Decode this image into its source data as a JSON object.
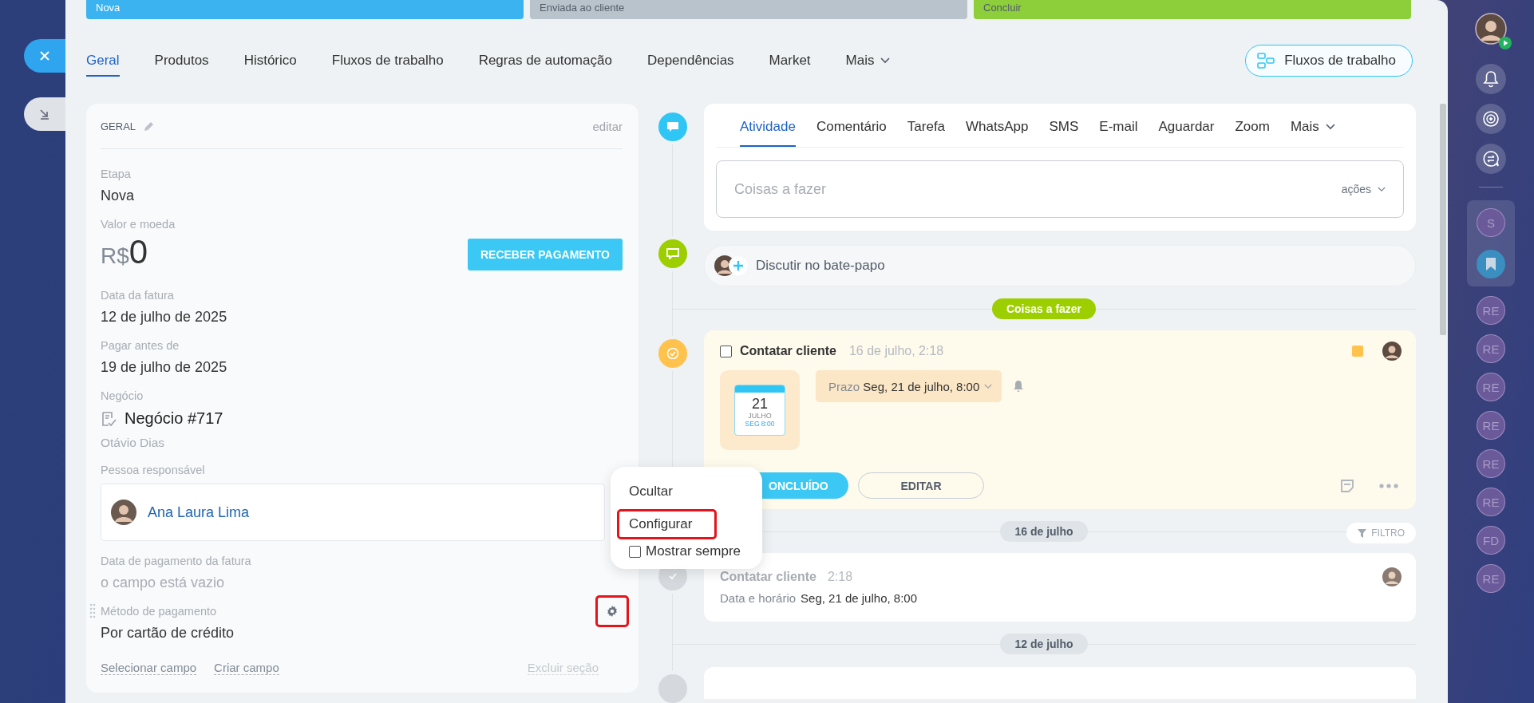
{
  "stages": [
    {
      "label": "Nova",
      "color": "#3bb3f0"
    },
    {
      "label": "Enviada ao cliente",
      "color": "#b9c3cc"
    },
    {
      "label": "Concluir",
      "color": "#8ccf3b"
    }
  ],
  "tabs": [
    {
      "label": "Geral",
      "selected": true
    },
    {
      "label": "Produtos",
      "selected": false
    },
    {
      "label": "Histórico",
      "selected": false
    },
    {
      "label": "Fluxos de trabalho",
      "selected": false
    },
    {
      "label": "Regras de automação",
      "selected": false
    },
    {
      "label": "Dependências",
      "selected": false
    },
    {
      "label": "Market",
      "selected": false
    },
    {
      "label": "Mais",
      "selected": false,
      "kind": "more"
    }
  ],
  "workflow_button": "Fluxos de trabalho",
  "section": {
    "title": "GERAL",
    "edit": "editar",
    "fields": [
      {
        "kind": "text",
        "label": "Etapa",
        "value": "Nova"
      },
      {
        "kind": "money",
        "label": "Valor e moeda",
        "currency": "R$",
        "amount": "0",
        "button": "RECEBER PAGAMENTO"
      },
      {
        "kind": "text",
        "label": "Data da fatura",
        "value": "12 de julho de 2025"
      },
      {
        "kind": "text",
        "label": "Pagar antes de",
        "value": "19 de julho de 2025"
      },
      {
        "kind": "deal",
        "label": "Negócio",
        "value": "Negócio #717",
        "sub": "Otávio Dias"
      },
      {
        "kind": "person",
        "label": "Pessoa responsável",
        "value": "Ana Laura Lima"
      },
      {
        "kind": "empty",
        "label": "Data de pagamento da fatura",
        "value": "o campo está vazio"
      },
      {
        "kind": "settings",
        "label": "Método de pagamento",
        "value": "Por cartão de crédito",
        "highlighted": true
      }
    ],
    "links": [
      "Selecionar campo",
      "Criar campo"
    ],
    "delete": "Excluir seção"
  },
  "context_menu": [
    {
      "kind": "action",
      "label": "Ocultar",
      "highlighted": false
    },
    {
      "kind": "action",
      "label": "Configurar",
      "highlighted": true
    },
    {
      "kind": "checkbox",
      "label": "Mostrar sempre",
      "checked": false
    }
  ],
  "activity_tabs": [
    {
      "label": "Atividade",
      "selected": true
    },
    {
      "label": "Comentário",
      "selected": false
    },
    {
      "label": "Tarefa",
      "selected": false
    },
    {
      "label": "WhatsApp",
      "selected": false
    },
    {
      "label": "SMS",
      "selected": false
    },
    {
      "label": "E-mail",
      "selected": false
    },
    {
      "label": "Aguardar",
      "selected": false
    },
    {
      "label": "Zoom",
      "selected": false
    },
    {
      "label": "Mais",
      "selected": false,
      "kind": "more"
    }
  ],
  "activity_input": {
    "placeholder": "Coisas a fazer",
    "actions": "ações"
  },
  "chat": "Discutir no bate-papo",
  "todo_pill": "Coisas a fazer",
  "task": {
    "title": "Contatar cliente",
    "time": "16 de julho, 2:18",
    "checked": false,
    "calendar_day": "21",
    "calendar_month": "JULHO",
    "calendar_time": "SEG 8:00",
    "deadline_label": "Prazo",
    "deadline": "Seg, 21 de julho, 8:00",
    "done_button": "ONCLUÍDO",
    "edit_button": "EDITAR"
  },
  "date_1": "16 de julho",
  "filter": "FILTRO",
  "record": {
    "title": "Contatar cliente",
    "time": "2:18",
    "label": "Data e horário",
    "value": "Seg, 21 de julho, 8:00"
  },
  "date_2": "12 de julho",
  "sidebar": {
    "group": [
      {
        "kind": "letters",
        "text": "S"
      },
      {
        "kind": "bookmark"
      }
    ],
    "chats": [
      "RE",
      "RE",
      "RE",
      "RE",
      "RE",
      "RE",
      "FD",
      "RE"
    ]
  }
}
